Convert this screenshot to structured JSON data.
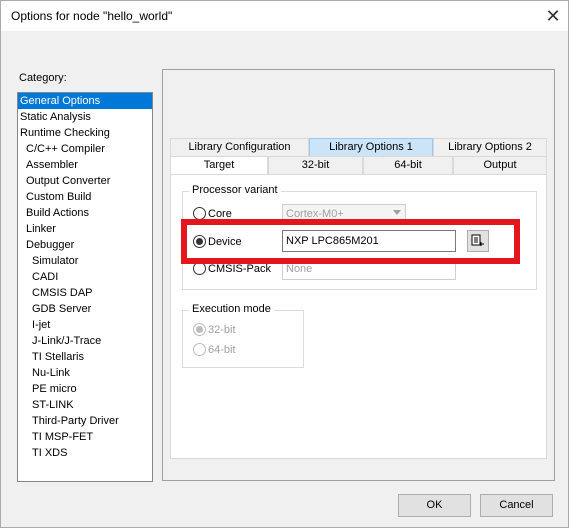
{
  "window": {
    "title": "Options for node \"hello_world\""
  },
  "category": {
    "label": "Category:",
    "items": [
      {
        "label": "General Options",
        "selected": true
      },
      {
        "label": "Static Analysis"
      },
      {
        "label": "Runtime Checking"
      },
      {
        "label": "C/C++ Compiler"
      },
      {
        "label": "Assembler"
      },
      {
        "label": "Output Converter"
      },
      {
        "label": "Custom Build"
      },
      {
        "label": "Build Actions"
      },
      {
        "label": "Linker"
      },
      {
        "label": "Debugger"
      },
      {
        "label": "Simulator"
      },
      {
        "label": "CADI"
      },
      {
        "label": "CMSIS DAP"
      },
      {
        "label": "GDB Server"
      },
      {
        "label": "I-jet"
      },
      {
        "label": "J-Link/J-Trace"
      },
      {
        "label": "TI Stellaris"
      },
      {
        "label": "Nu-Link"
      },
      {
        "label": "PE micro"
      },
      {
        "label": "ST-LINK"
      },
      {
        "label": "Third-Party Driver"
      },
      {
        "label": "TI MSP-FET"
      },
      {
        "label": "TI XDS"
      }
    ]
  },
  "tabs": {
    "row1": [
      "Library Configuration",
      "Library Options 1",
      "Library Options 2"
    ],
    "row2": [
      "Target",
      "32-bit",
      "64-bit",
      "Output"
    ]
  },
  "processor": {
    "group_title": "Processor variant",
    "core_label": "Core",
    "core_value": "Cortex-M0+",
    "device_label": "Device",
    "device_value": "NXP LPC865M201",
    "cmsis_label": "CMSIS-Pack",
    "cmsis_value": "None"
  },
  "execution": {
    "group_title": "Execution mode",
    "opt_32": "32-bit",
    "opt_64": "64-bit"
  },
  "buttons": {
    "ok": "OK",
    "cancel": "Cancel"
  }
}
